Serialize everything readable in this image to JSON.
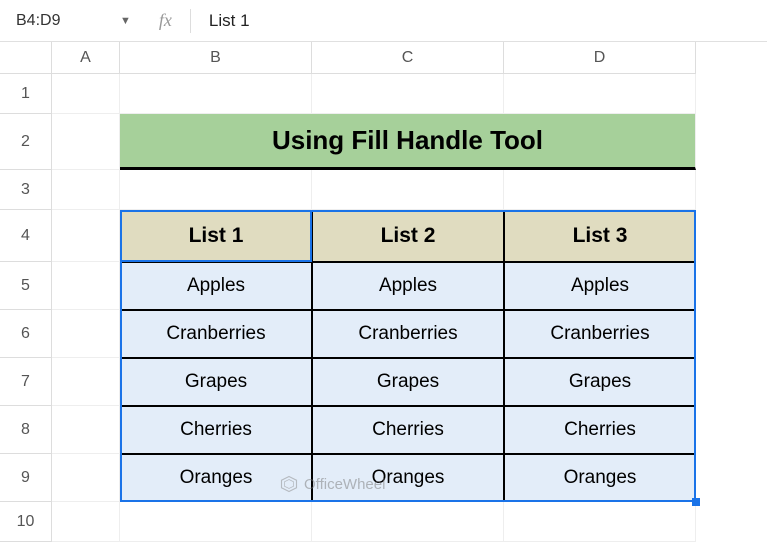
{
  "toolbar": {
    "name_box": "B4:D9",
    "fx_label": "fx",
    "formula_value": "List 1"
  },
  "columns": [
    "A",
    "B",
    "C",
    "D"
  ],
  "rows": [
    "1",
    "2",
    "3",
    "4",
    "5",
    "6",
    "7",
    "8",
    "9",
    "10"
  ],
  "title": "Using Fill Handle Tool",
  "chart_data": {
    "type": "table",
    "headers": [
      "List 1",
      "List 2",
      "List 3"
    ],
    "rows": [
      [
        "Apples",
        "Apples",
        "Apples"
      ],
      [
        "Cranberries",
        "Cranberries",
        "Cranberries"
      ],
      [
        "Grapes",
        "Grapes",
        "Grapes"
      ],
      [
        "Cherries",
        "Cherries",
        "Cherries"
      ],
      [
        "Oranges",
        "Oranges",
        "Oranges"
      ]
    ]
  },
  "watermark": "OfficeWheel",
  "selection": {
    "range": "B4:D9",
    "active": "B4"
  }
}
